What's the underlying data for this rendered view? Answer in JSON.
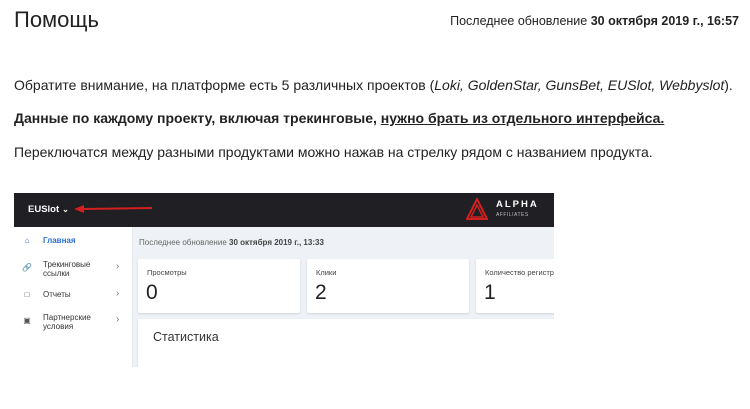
{
  "page": {
    "title": "Помощь",
    "updated_label": "Последнее обновление",
    "updated_value": "30 октября 2019 г., 16:57"
  },
  "content": {
    "p1_prefix": "Обратите внимание, на платформе есть 5 различных проектов (",
    "p1_projects": "Loki, GoldenStar, GunsBet, EUSlot, Webbyslot",
    "p1_suffix": ").",
    "p2_prefix": "Данные по каждому проекту, включая трекинговые, ",
    "p2_link": "нужно брать из отдельного интерфейса.",
    "p3": "Переключатся между разными продуктами можно нажав на стрелку рядом с названием продукта."
  },
  "screenshot": {
    "product": "EUSlot",
    "logo_main": "ALPHA",
    "logo_sub": "AFFILIATES",
    "arrow_color": "#d21f1f",
    "sidebar": [
      {
        "label": "Главная",
        "icon": "home-icon",
        "active": true
      },
      {
        "label": "Трекинговые ссылки",
        "icon": "link-icon"
      },
      {
        "label": "Отчеты",
        "icon": "report-icon"
      },
      {
        "label": "Партнерские условия",
        "icon": "briefcase-icon"
      }
    ],
    "updated_label": "Последнее обновление",
    "updated_value": "30 октября 2019 г., 13:33",
    "cards": [
      {
        "label": "Просмотры",
        "value": "0"
      },
      {
        "label": "Клики",
        "value": "2"
      },
      {
        "label": "Количество регистр",
        "value": "1"
      }
    ],
    "stats_title": "Статистика"
  }
}
